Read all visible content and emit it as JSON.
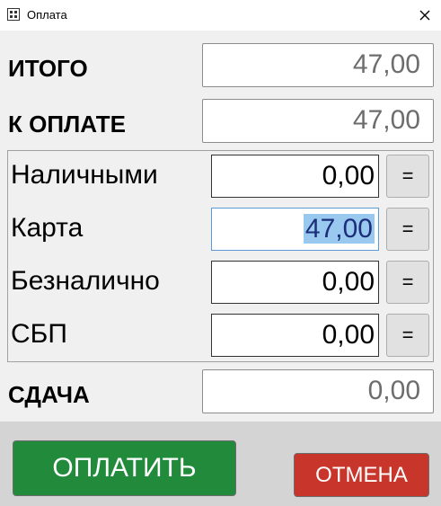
{
  "window": {
    "title": "Оплата",
    "icon": "app-grid-icon",
    "close_icon": "close-icon"
  },
  "summary": {
    "total_label": "ИТОГО",
    "total_value": "47,00",
    "to_pay_label": "К ОПЛАТЕ",
    "to_pay_value": "47,00",
    "change_label": "СДАЧА",
    "change_value": "0,00"
  },
  "methods": [
    {
      "label": "Наличными",
      "value": "0,00",
      "eq": "="
    },
    {
      "label": "Карта",
      "value": "47,00",
      "eq": "="
    },
    {
      "label": "Безналично",
      "value": "0,00",
      "eq": "="
    },
    {
      "label": "СБП",
      "value": "0,00",
      "eq": "="
    }
  ],
  "actions": {
    "pay_label": "ОПЛАТИТЬ",
    "cancel_label": "ОТМЕНА"
  },
  "colors": {
    "pay": "#228b3b",
    "cancel": "#c8352b",
    "selection": "#99c9ef"
  }
}
